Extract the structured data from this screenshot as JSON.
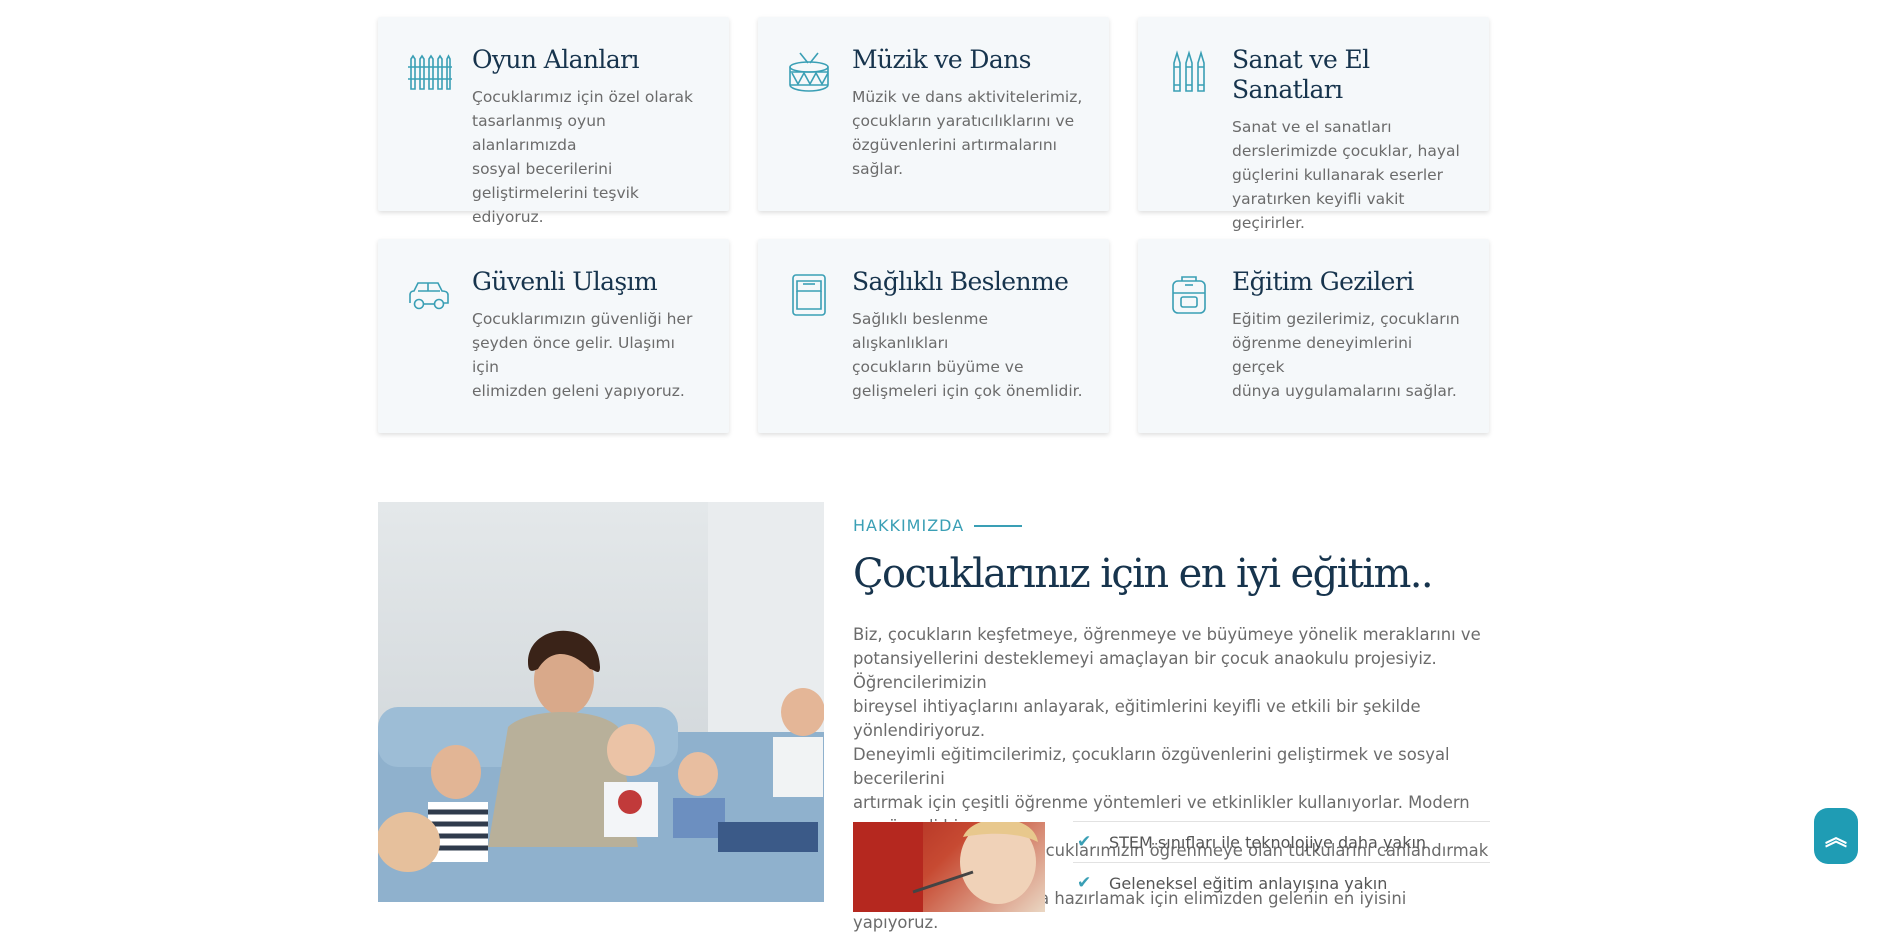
{
  "services": [
    {
      "icon": "fence-icon",
      "title": "Oyun Alanları",
      "lines": [
        "Çocuklarımız için özel olarak",
        "tasarlanmış oyun alanlarımızda",
        "sosyal becerilerini",
        "geliştirmelerini teşvik ediyoruz."
      ]
    },
    {
      "icon": "drum-icon",
      "title": "Müzik ve Dans",
      "lines": [
        "Müzik ve dans aktivitelerimiz,",
        "çocukların yaratıcılıklarını ve",
        "özgüvenlerini artırmalarını",
        "sağlar."
      ]
    },
    {
      "icon": "crayons-icon",
      "title": "Sanat ve El Sanatları",
      "lines": [
        "Sanat ve el sanatları",
        "derslerimizde çocuklar, hayal",
        "güçlerini kullanarak eserler",
        "yaratırken keyifli vakit geçirirler."
      ]
    },
    {
      "icon": "car-icon",
      "title": "Güvenli Ulaşım",
      "lines": [
        "Çocuklarımızın güvenliği her",
        "şeyden önce gelir. Ulaşımı için",
        "elimizden geleni yapıyoruz."
      ]
    },
    {
      "icon": "lunchbox-icon",
      "title": "Sağlıklı Beslenme",
      "lines": [
        "Sağlıklı beslenme alışkanlıkları",
        "çocukların büyüme ve",
        "gelişmeleri için çok önemlidir."
      ]
    },
    {
      "icon": "backpack-icon",
      "title": "Eğitim Gezileri",
      "lines": [
        "Eğitim gezilerimiz, çocukların",
        "öğrenme deneyimlerini gerçek",
        "dünya uygulamalarını sağlar."
      ]
    }
  ],
  "about": {
    "eyebrow": "HAKKIMIZDA",
    "title": "Çocuklarınız için en iyi eğitim..",
    "lines": [
      "Biz, çocukların keşfetmeye, öğrenmeye ve büyümeye yönelik meraklarını ve",
      "potansiyellerini desteklemeyi amaçlayan bir çocuk anaokulu projesiyiz. Öğrencilerimizin",
      "bireysel ihtiyaçlarını anlayarak, eğitimlerini keyifli ve etkili bir şekilde yönlendiriyoruz.",
      "Deneyimli eğitimcilerimiz, çocukların özgüvenlerini geliştirmek ve sosyal becerilerini",
      "artırmak için çeşitli öğrenme yöntemleri ve etkinlikler kullanıyorlar. Modern ve güvenli bir",
      "öğrenme ortamında, çocuklarımızın öğrenmeye olan tutkularını canlandırmak ve onları",
      "gelecekteki başarılarına hazırlamak için elimizden gelenin en iyisini yapıyoruz."
    ],
    "features": [
      "STEM sınıfları ile teknolojiye daha yakın",
      "Geleneksel eğitim anlayışına yakın"
    ]
  },
  "colors": {
    "accent": "#3a9fb5",
    "heading": "#17344d",
    "card_bg": "#f5f8fa",
    "back_to_top": "#1f9cb4"
  }
}
